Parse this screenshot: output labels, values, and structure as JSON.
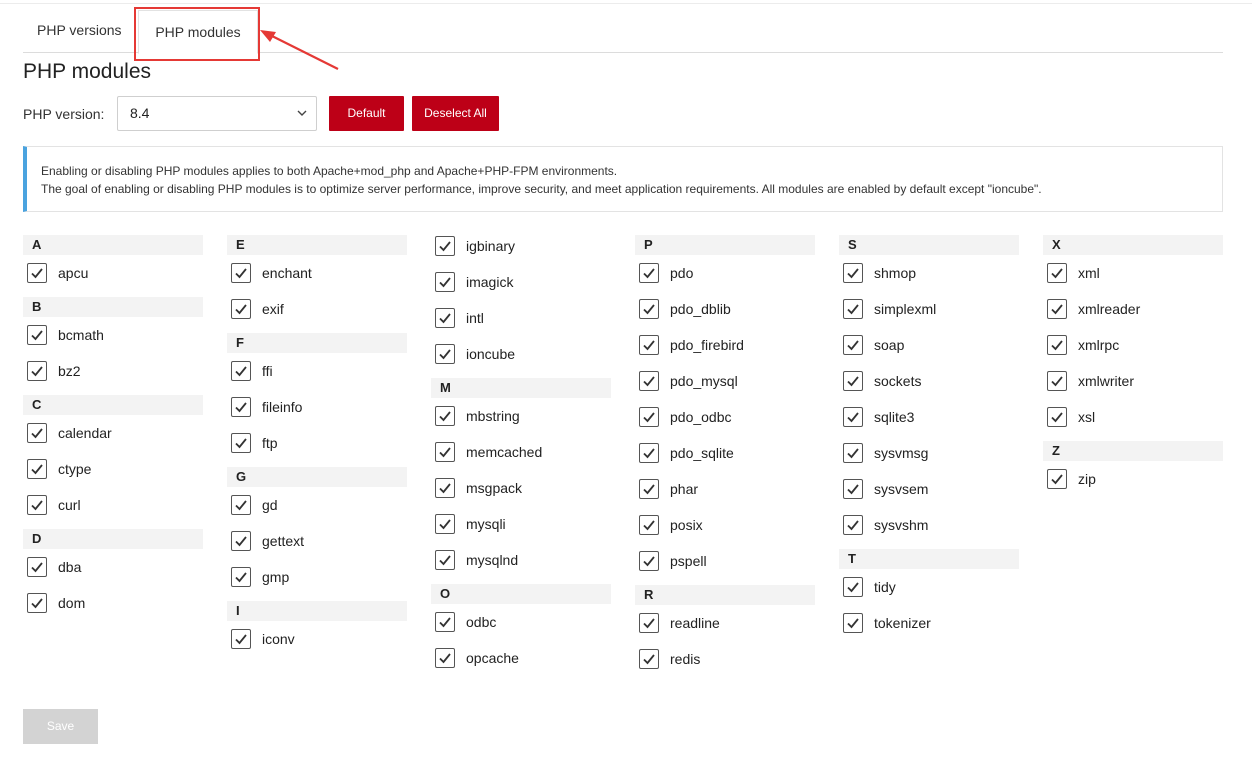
{
  "tabs": {
    "versions": "PHP versions",
    "modules": "PHP modules"
  },
  "page_title": "PHP modules",
  "version": {
    "label": "PHP version:",
    "selected": "8.4"
  },
  "buttons": {
    "default": "Default",
    "deselect_all": "Deselect All",
    "save": "Save"
  },
  "info": {
    "line1": "Enabling or disabling PHP modules applies to both Apache+mod_php and Apache+PHP-FPM environments.",
    "line2": "The goal of enabling or disabling PHP modules is to optimize server performance, improve security, and meet application requirements. All modules are enabled by default except \"ioncube\"."
  },
  "columns": [
    [
      {
        "letter": "A",
        "modules": [
          "apcu"
        ]
      },
      {
        "letter": "B",
        "modules": [
          "bcmath",
          "bz2"
        ]
      },
      {
        "letter": "C",
        "modules": [
          "calendar",
          "ctype",
          "curl"
        ]
      },
      {
        "letter": "D",
        "modules": [
          "dba",
          "dom"
        ]
      }
    ],
    [
      {
        "letter": "E",
        "modules": [
          "enchant",
          "exif"
        ]
      },
      {
        "letter": "F",
        "modules": [
          "ffi",
          "fileinfo",
          "ftp"
        ]
      },
      {
        "letter": "G",
        "modules": [
          "gd",
          "gettext",
          "gmp"
        ]
      },
      {
        "letter": "I",
        "modules": [
          "iconv"
        ]
      }
    ],
    [
      {
        "letter": "",
        "modules": [
          "igbinary",
          "imagick",
          "intl",
          "ioncube"
        ]
      },
      {
        "letter": "M",
        "modules": [
          "mbstring",
          "memcached",
          "msgpack",
          "mysqli",
          "mysqlnd"
        ]
      },
      {
        "letter": "O",
        "modules": [
          "odbc",
          "opcache"
        ]
      }
    ],
    [
      {
        "letter": "P",
        "modules": [
          "pdo",
          "pdo_dblib",
          "pdo_firebird",
          "pdo_mysql",
          "pdo_odbc",
          "pdo_sqlite",
          "phar",
          "posix",
          "pspell"
        ]
      },
      {
        "letter": "R",
        "modules": [
          "readline",
          "redis"
        ]
      }
    ],
    [
      {
        "letter": "S",
        "modules": [
          "shmop",
          "simplexml",
          "soap",
          "sockets",
          "sqlite3",
          "sysvmsg",
          "sysvsem",
          "sysvshm"
        ]
      },
      {
        "letter": "T",
        "modules": [
          "tidy",
          "tokenizer"
        ]
      }
    ],
    [
      {
        "letter": "X",
        "modules": [
          "xml",
          "xmlreader",
          "xmlrpc",
          "xmlwriter",
          "xsl"
        ]
      },
      {
        "letter": "Z",
        "modules": [
          "zip"
        ]
      }
    ]
  ],
  "colors": {
    "primary_red": "#bd0017",
    "info_accent": "#4aa3df",
    "annotation_red": "#e53935"
  }
}
